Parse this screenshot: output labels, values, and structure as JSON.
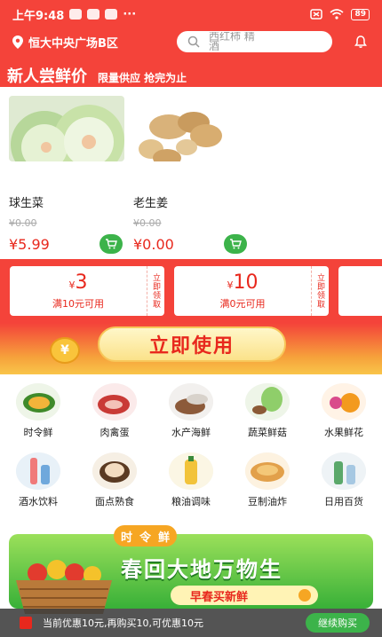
{
  "status_bar": {
    "time": "上午9:48",
    "dots": "···",
    "battery": "89"
  },
  "header": {
    "location": "恒大中央广场B区",
    "search_placeholder": "西红柿 精酒"
  },
  "promo": {
    "title": "新人尝鲜价",
    "subtitle": "限量供应 抢完为止",
    "products": [
      {
        "name": "球生菜",
        "old_price": "¥0.00",
        "price": "¥5.99"
      },
      {
        "name": "老生姜",
        "old_price": "¥0.00",
        "price": "¥0.00"
      }
    ]
  },
  "coupons": [
    {
      "currency": "¥",
      "amount": "3",
      "condition": "满10元可用",
      "action": "立即领取"
    },
    {
      "currency": "¥",
      "amount": "10",
      "condition": "满0元可用",
      "action": "立即领取"
    }
  ],
  "use_button": "立即使用",
  "coin_symbol": "¥",
  "categories": [
    {
      "label": "时令鲜",
      "icon": "melon-icon"
    },
    {
      "label": "肉禽蛋",
      "icon": "meat-icon"
    },
    {
      "label": "水产海鲜",
      "icon": "crab-icon"
    },
    {
      "label": "蔬菜鲜菇",
      "icon": "cabbage-icon"
    },
    {
      "label": "水果鲜花",
      "icon": "fruit-icon"
    },
    {
      "label": "酒水饮料",
      "icon": "drink-icon"
    },
    {
      "label": "面点熟食",
      "icon": "bun-icon"
    },
    {
      "label": "粮油调味",
      "icon": "oil-icon"
    },
    {
      "label": "豆制油炸",
      "icon": "tofu-icon"
    },
    {
      "label": "日用百货",
      "icon": "bottle-icon"
    }
  ],
  "banner": {
    "pill": [
      "时",
      "令",
      "鲜"
    ],
    "slogan": "春回大地万物生",
    "cta": "早春买新鲜"
  },
  "bottom_bar": {
    "text": "当前优惠10元,再购买10,可优惠10元",
    "button": "继续购买"
  },
  "colors": {
    "brand_red": "#f4433a",
    "price_red": "#e8281d",
    "green": "#3cb34a"
  }
}
